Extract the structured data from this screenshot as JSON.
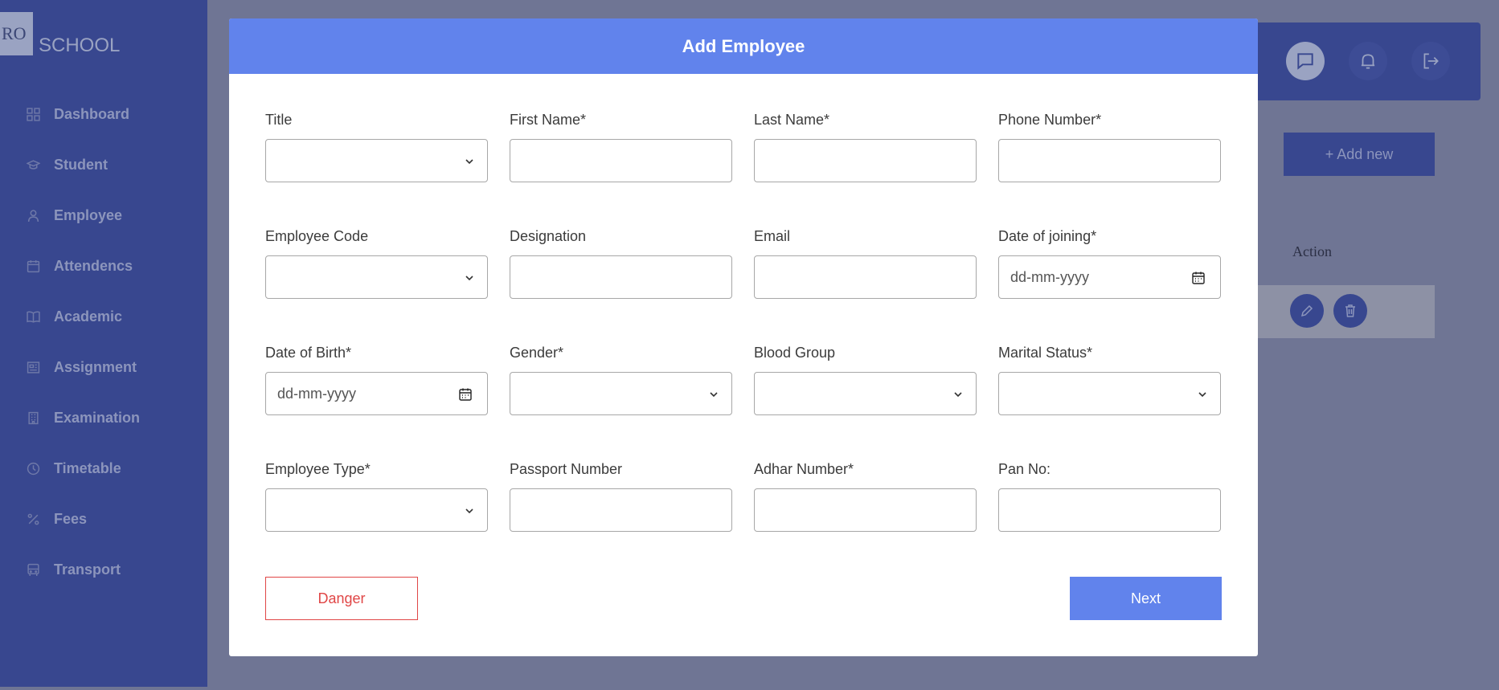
{
  "app": {
    "logo_mark": "RO",
    "logo_text": "SCHOOL"
  },
  "sidebar": {
    "items": [
      {
        "label": "Dashboard",
        "icon": "grid-icon"
      },
      {
        "label": "Student",
        "icon": "graduation-cap-icon"
      },
      {
        "label": "Employee",
        "icon": "user-icon"
      },
      {
        "label": "Attendencs",
        "icon": "calendar-icon"
      },
      {
        "label": "Academic",
        "icon": "book-icon"
      },
      {
        "label": "Assignment",
        "icon": "newspaper-icon"
      },
      {
        "label": "Examination",
        "icon": "building-icon"
      },
      {
        "label": "Timetable",
        "icon": "clock-icon"
      },
      {
        "label": "Fees",
        "icon": "percent-icon"
      },
      {
        "label": "Transport",
        "icon": "bus-icon"
      }
    ]
  },
  "page": {
    "add_new_label": "+ Add new",
    "table_action_header": "Action"
  },
  "modal": {
    "title": "Add Employee",
    "fields": [
      {
        "label": "Title",
        "type": "select",
        "value": ""
      },
      {
        "label": "First Name*",
        "type": "text",
        "value": ""
      },
      {
        "label": "Last Name*",
        "type": "text",
        "value": ""
      },
      {
        "label": "Phone Number*",
        "type": "text",
        "value": ""
      },
      {
        "label": "Employee Code",
        "type": "select",
        "value": ""
      },
      {
        "label": "Designation",
        "type": "text",
        "value": ""
      },
      {
        "label": "Email",
        "type": "text",
        "value": ""
      },
      {
        "label": "Date of joining*",
        "type": "date",
        "value": "dd-mm-yyyy"
      },
      {
        "label": "Date of Birth*",
        "type": "date",
        "value": "dd-mm-yyyy"
      },
      {
        "label": "Gender*",
        "type": "select",
        "value": ""
      },
      {
        "label": "Blood Group",
        "type": "select",
        "value": ""
      },
      {
        "label": "Marital Status*",
        "type": "select",
        "value": ""
      },
      {
        "label": "Employee Type*",
        "type": "select",
        "value": ""
      },
      {
        "label": "Passport Number",
        "type": "text",
        "value": ""
      },
      {
        "label": "Adhar Number*",
        "type": "text",
        "value": ""
      },
      {
        "label": "Pan No:",
        "type": "text",
        "value": ""
      }
    ],
    "danger_label": "Danger",
    "next_label": "Next"
  },
  "colors": {
    "primary": "#6183ec",
    "sidebar": "#38478f",
    "danger": "#e04646",
    "overlay": "#6f7594"
  }
}
